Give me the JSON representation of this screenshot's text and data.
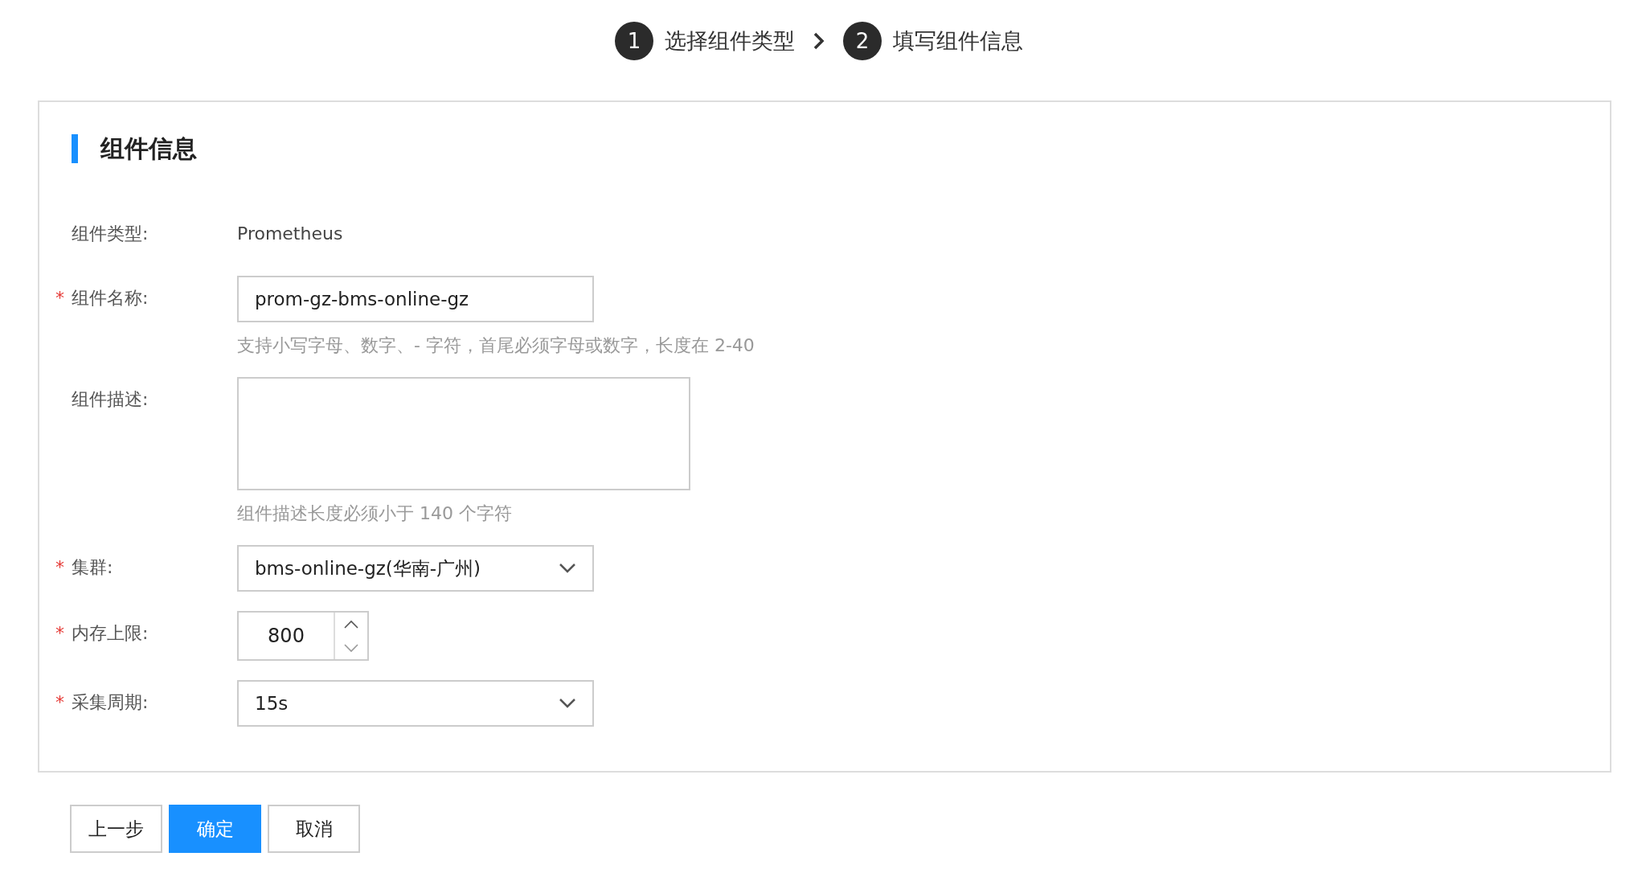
{
  "steps": [
    {
      "number": "1",
      "label": "选择组件类型"
    },
    {
      "number": "2",
      "label": "填写组件信息"
    }
  ],
  "section": {
    "title": "组件信息"
  },
  "fields": [
    {
      "kind": "text",
      "label": "组件类型:",
      "value": "Prometheus"
    },
    {
      "kind": "input",
      "required_mark": "*",
      "label": "组件名称:",
      "value": "prom-gz-bms-online-gz",
      "hint": "支持小写字母、数字、- 字符，首尾必须字母或数字，长度在 2-40"
    },
    {
      "kind": "textarea",
      "label": "组件描述:",
      "hint": "组件描述长度必须小于 140 个字符"
    },
    {
      "kind": "select",
      "required_mark": "*",
      "label": "集群:",
      "value": "bms-online-gz(华南-广州)"
    },
    {
      "kind": "number",
      "required_mark": "*",
      "label": "内存上限:",
      "value": "800"
    },
    {
      "kind": "select",
      "required_mark": "*",
      "label": "采集周期:",
      "value": "15s"
    }
  ],
  "buttons": [
    {
      "label": "上一步",
      "primary": false
    },
    {
      "label": "确定",
      "primary": true
    },
    {
      "label": "取消",
      "primary": false
    }
  ]
}
